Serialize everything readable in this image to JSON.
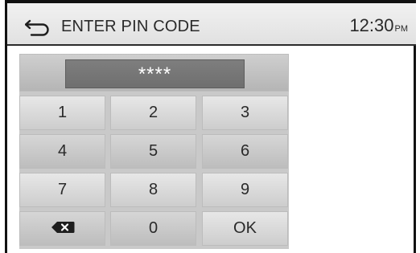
{
  "header": {
    "back_icon": "back-arrow-icon",
    "title": "ENTER PIN CODE",
    "clock_time": "12:30",
    "clock_ampm": "PM"
  },
  "pin": {
    "masked_value": "****"
  },
  "keypad": {
    "k1": "1",
    "k2": "2",
    "k3": "3",
    "k4": "4",
    "k5": "5",
    "k6": "6",
    "k7": "7",
    "k8": "8",
    "k9": "9",
    "k0": "0",
    "ok": "OK",
    "backspace_icon": "backspace-icon"
  },
  "colors": {
    "header_bg": "#e8e8e8",
    "pin_display_bg": "#757575",
    "key_bg": "#dcdcdc",
    "text": "#2a2a2a"
  }
}
